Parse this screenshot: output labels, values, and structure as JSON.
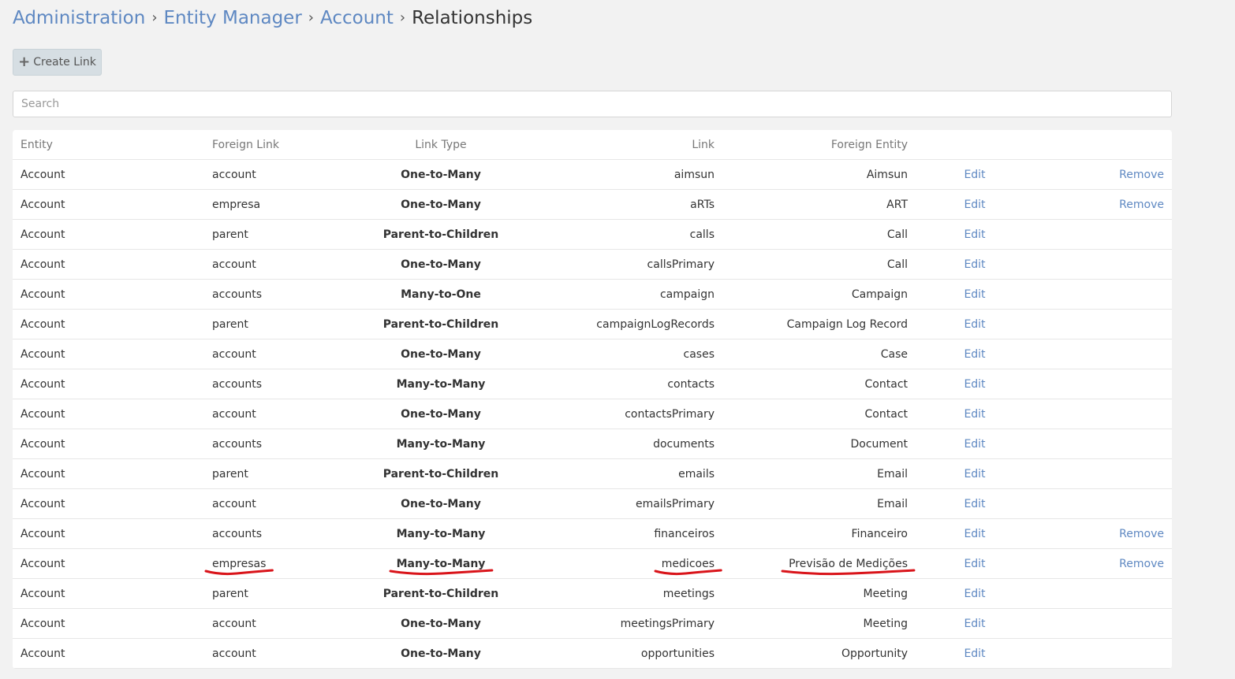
{
  "breadcrumb": {
    "items": [
      "Administration",
      "Entity Manager",
      "Account"
    ],
    "current": "Relationships",
    "separator": "›"
  },
  "toolbar": {
    "create_link_label": "Create Link",
    "create_icon": "plus-icon"
  },
  "search": {
    "placeholder": "Search",
    "value": ""
  },
  "table": {
    "headers": [
      "Entity",
      "Foreign Link",
      "Link Type",
      "Link",
      "Foreign Entity"
    ],
    "edit_label": "Edit",
    "remove_label": "Remove",
    "rows": [
      {
        "entity": "Account",
        "foreign_link": "account",
        "link_type": "One-to-Many",
        "link": "aimsun",
        "foreign_entity": "Aimsun",
        "removable": true
      },
      {
        "entity": "Account",
        "foreign_link": "empresa",
        "link_type": "One-to-Many",
        "link": "aRTs",
        "foreign_entity": "ART",
        "removable": true
      },
      {
        "entity": "Account",
        "foreign_link": "parent",
        "link_type": "Parent-to-Children",
        "link": "calls",
        "foreign_entity": "Call",
        "removable": false
      },
      {
        "entity": "Account",
        "foreign_link": "account",
        "link_type": "One-to-Many",
        "link": "callsPrimary",
        "foreign_entity": "Call",
        "removable": false
      },
      {
        "entity": "Account",
        "foreign_link": "accounts",
        "link_type": "Many-to-One",
        "link": "campaign",
        "foreign_entity": "Campaign",
        "removable": false
      },
      {
        "entity": "Account",
        "foreign_link": "parent",
        "link_type": "Parent-to-Children",
        "link": "campaignLogRecords",
        "foreign_entity": "Campaign Log Record",
        "removable": false
      },
      {
        "entity": "Account",
        "foreign_link": "account",
        "link_type": "One-to-Many",
        "link": "cases",
        "foreign_entity": "Case",
        "removable": false
      },
      {
        "entity": "Account",
        "foreign_link": "accounts",
        "link_type": "Many-to-Many",
        "link": "contacts",
        "foreign_entity": "Contact",
        "removable": false
      },
      {
        "entity": "Account",
        "foreign_link": "account",
        "link_type": "One-to-Many",
        "link": "contactsPrimary",
        "foreign_entity": "Contact",
        "removable": false
      },
      {
        "entity": "Account",
        "foreign_link": "accounts",
        "link_type": "Many-to-Many",
        "link": "documents",
        "foreign_entity": "Document",
        "removable": false
      },
      {
        "entity": "Account",
        "foreign_link": "parent",
        "link_type": "Parent-to-Children",
        "link": "emails",
        "foreign_entity": "Email",
        "removable": false
      },
      {
        "entity": "Account",
        "foreign_link": "account",
        "link_type": "One-to-Many",
        "link": "emailsPrimary",
        "foreign_entity": "Email",
        "removable": false
      },
      {
        "entity": "Account",
        "foreign_link": "accounts",
        "link_type": "Many-to-Many",
        "link": "financeiros",
        "foreign_entity": "Financeiro",
        "removable": true
      },
      {
        "entity": "Account",
        "foreign_link": "empresas",
        "link_type": "Many-to-Many",
        "link": "medicoes",
        "foreign_entity": "Previsão de Medições",
        "removable": true,
        "highlighted": true
      },
      {
        "entity": "Account",
        "foreign_link": "parent",
        "link_type": "Parent-to-Children",
        "link": "meetings",
        "foreign_entity": "Meeting",
        "removable": false
      },
      {
        "entity": "Account",
        "foreign_link": "account",
        "link_type": "One-to-Many",
        "link": "meetingsPrimary",
        "foreign_entity": "Meeting",
        "removable": false
      },
      {
        "entity": "Account",
        "foreign_link": "account",
        "link_type": "One-to-Many",
        "link": "opportunities",
        "foreign_entity": "Opportunity",
        "removable": false
      }
    ]
  },
  "colors": {
    "link": "#5e88c2",
    "background": "#f2f2f2",
    "annotation": "#d9141a"
  }
}
